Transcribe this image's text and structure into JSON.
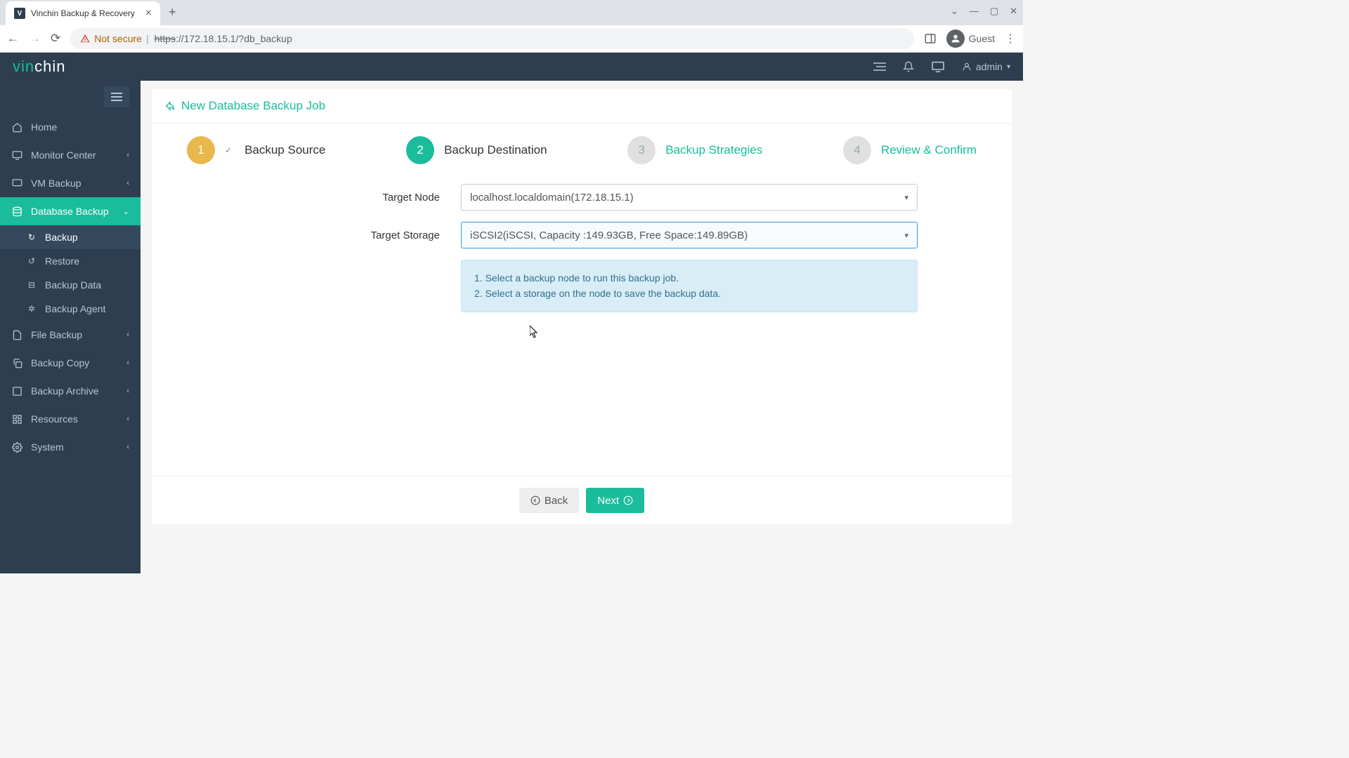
{
  "browser": {
    "tab_title": "Vinchin Backup & Recovery",
    "not_secure": "Not secure",
    "url_proto": "https",
    "url_rest": "://172.18.15.1/?db_backup",
    "guest": "Guest"
  },
  "header": {
    "user": "admin"
  },
  "sidebar": {
    "home": "Home",
    "monitor": "Monitor Center",
    "vm_backup": "VM Backup",
    "db_backup": "Database Backup",
    "sub_backup": "Backup",
    "sub_restore": "Restore",
    "sub_backup_data": "Backup Data",
    "sub_backup_agent": "Backup Agent",
    "file_backup": "File Backup",
    "backup_copy": "Backup Copy",
    "backup_archive": "Backup Archive",
    "resources": "Resources",
    "system": "System"
  },
  "page": {
    "title": "New Database Backup Job",
    "step1": "Backup Source",
    "step2": "Backup Destination",
    "step3": "Backup Strategies",
    "step4": "Review & Confirm",
    "step1_num": "1",
    "step2_num": "2",
    "step3_num": "3",
    "step4_num": "4"
  },
  "form": {
    "target_node_label": "Target Node",
    "target_node_value": "localhost.localdomain(172.18.15.1)",
    "target_storage_label": "Target Storage",
    "target_storage_value": "iSCSI2(iSCSI, Capacity :149.93GB, Free Space:149.89GB)",
    "info_line1": "1. Select a backup node to run this backup job.",
    "info_line2": "2. Select a storage on the node to save the backup data."
  },
  "buttons": {
    "back": "Back",
    "next": "Next"
  }
}
